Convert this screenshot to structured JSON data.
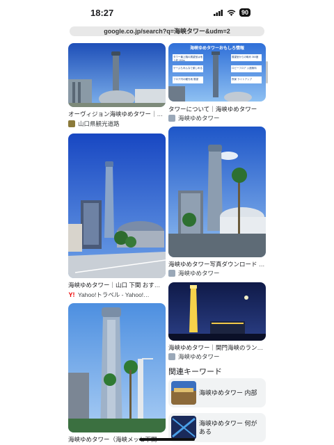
{
  "status": {
    "time": "18:27",
    "battery": "90"
  },
  "url": "google.co.jp/search?q=海峡タワー&udm=2",
  "results": {
    "r1": {
      "caption": "オーヴィジョン海峡ゆめタワー｜…",
      "source": "山口県観光道路"
    },
    "r2": {
      "caption": "タワーについて｜海峡ゆめタワー",
      "source": "海峡ゆめタワー",
      "infographic_title": "海峡ゆめタワーおもしろ情報",
      "infographic_items": [
        "タワー最上階の展望室は地上約 153m",
        "ゲームもみんなで楽しめる ",
        "フロア内の観光地 展望 ",
        "展望室からの眺め 360度",
        "ロビーフロア 入館無料",
        "夜景 ライトアップ"
      ]
    },
    "r3": {
      "caption": "海峡ゆめタワー｜山口 下関 おす…",
      "source": "Yahoo!トラベル - Yahoo!…"
    },
    "r4": {
      "caption": "海峡ゆめタワー写真ダウンロード …",
      "source": "海峡ゆめタワー"
    },
    "r5": {
      "caption": "海峡ゆめタワー｜関門海峡のラン…",
      "source": "海峡ゆめタワー"
    },
    "r6": {
      "caption": "海峡ゆめタワー（海峡メッセ下関"
    }
  },
  "related": {
    "title": "関連キーワード",
    "items": [
      {
        "label": "海峡ゆめタワー 内部"
      },
      {
        "label": "海峡ゆめタワー 何がある"
      }
    ]
  },
  "colors": {
    "sky": "#2d5fd0",
    "accent": "#1a73e8"
  }
}
